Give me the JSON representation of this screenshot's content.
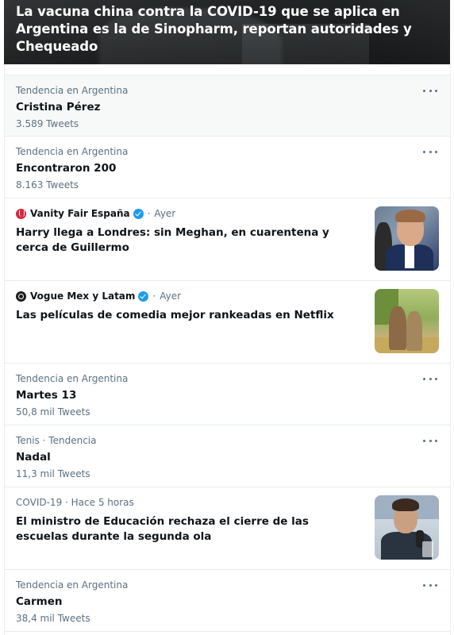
{
  "hero": {
    "title": "La vacuna china contra la COVID-19 que se aplica en Argentina es la de Sinopharm, reportan autoridades y Chequeado"
  },
  "trends": [
    {
      "meta": "Tendencia en Argentina",
      "name": "Cristina Pérez",
      "count": "3.589 Tweets"
    },
    {
      "meta": "Tendencia en Argentina",
      "name": "Encontraron 200",
      "count": "8.163 Tweets"
    }
  ],
  "news1": {
    "source": "Vanity Fair España",
    "dot": "·",
    "time": "Ayer",
    "headline": "Harry llega a Londres: sin Meghan, en cuarentena y cerca de Guillermo"
  },
  "news2": {
    "source": "Vogue Mex y Latam",
    "dot": "·",
    "time": "Ayer",
    "headline": "Las películas de comedia mejor rankeadas en Netflix"
  },
  "trends2": [
    {
      "meta": "Tendencia en Argentina",
      "name": "Martes 13",
      "count": "50,8 mil Tweets"
    },
    {
      "meta": "Tenis · Tendencia",
      "name": "Nadal",
      "count": "11,3 mil Tweets"
    }
  ],
  "news3": {
    "meta": "COVID-19 · Hace 5 horas",
    "headline": "El ministro de Educación rechaza el cierre de las escuelas durante la segunda ola"
  },
  "trends3": [
    {
      "meta": "Tendencia en Argentina",
      "name": "Carmen",
      "count": "38,4 mil Tweets"
    }
  ],
  "icons": {
    "more": "more-horizontal-icon",
    "verified": "verified-badge-icon"
  },
  "colors": {
    "secondary_text": "#5b7083",
    "verified": "#1d9bf0",
    "divider": "#e6ecf0"
  }
}
